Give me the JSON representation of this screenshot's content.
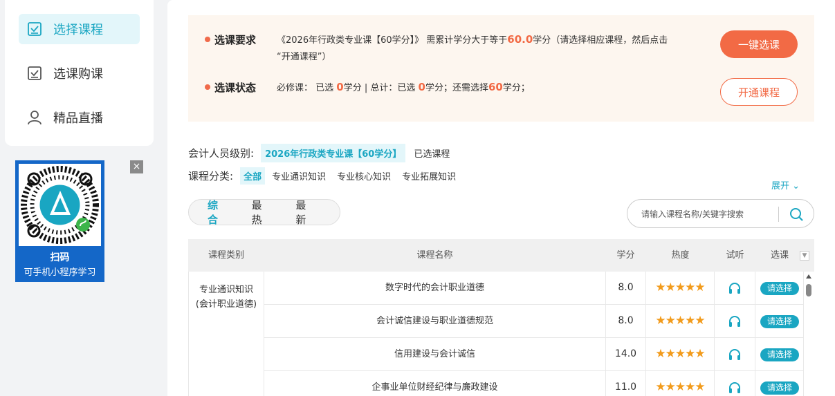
{
  "sidebar": {
    "items": [
      {
        "label": "选择课程",
        "icon": "checkbox-icon",
        "active": true
      },
      {
        "label": "选课购课",
        "icon": "checkbox-icon",
        "active": false
      },
      {
        "label": "精品直播",
        "icon": "user-icon",
        "active": false
      }
    ]
  },
  "qr": {
    "title": "扫码",
    "subtitle": "可手机小程序学习",
    "close": "×"
  },
  "requirement": {
    "label": "选课要求",
    "text_before": "《2026年行政类专业课【60学分】》 需累计学分大于等于",
    "credits": "60.0",
    "text_after": "学分（请选择相应课程，然后点击",
    "text_line2": "“开通课程”）"
  },
  "status": {
    "label": "选课状态",
    "t1": "必修课： 已选",
    "v1": "0",
    "t2": "学分 | 总计：已选",
    "v2": "0",
    "t3": "学分；还需选择",
    "v3": "60",
    "t4": "学分；"
  },
  "buttons": {
    "one_click": "一键选课",
    "open": "开通课程"
  },
  "level": {
    "label": "会计人员级别:",
    "chip": "2026年行政类专业课【60学分】",
    "selected": "已选课程"
  },
  "category": {
    "label": "课程分类:",
    "options": [
      "全部",
      "专业通识知识",
      "专业核心知识",
      "专业拓展知识"
    ],
    "expand": "展开"
  },
  "sort": {
    "options": [
      "综合",
      "最热",
      "最新"
    ]
  },
  "search": {
    "placeholder": "请输入课程名称/关键字搜索"
  },
  "table": {
    "headers": [
      "课程类别",
      "课程名称",
      "学分",
      "热度",
      "试听",
      "选课"
    ],
    "category_line1": "专业通识知识",
    "category_line2": "(会计职业道德)",
    "rows": [
      {
        "name": "数字时代的会计职业道德",
        "credit": "8.0",
        "stars": "★★★★★",
        "action": "请选择"
      },
      {
        "name": "会计诚信建设与职业道德规范",
        "credit": "8.0",
        "stars": "★★★★★",
        "action": "请选择"
      },
      {
        "name": "信用建设与会计诚信",
        "credit": "14.0",
        "stars": "★★★★★",
        "action": "请选择"
      },
      {
        "name": "企事业单位财经纪律与廉政建设",
        "credit": "11.0",
        "stars": "★★★★★",
        "action": "请选择"
      }
    ]
  },
  "colors": {
    "accent": "#1aa6c2",
    "orange": "#f26a45",
    "star": "#f29b1c"
  }
}
